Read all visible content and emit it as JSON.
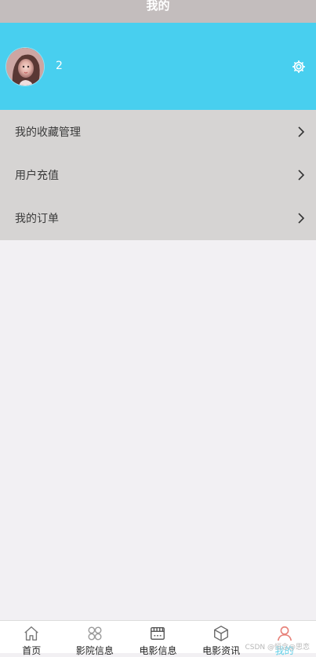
{
  "header": {
    "title": "我的"
  },
  "profile": {
    "username": "2",
    "settings_icon": "gear-icon",
    "avatar_icon": "avatar"
  },
  "menu": {
    "items": [
      {
        "label": "我的收藏管理",
        "icon": "chevron-right-icon"
      },
      {
        "label": "用户充值",
        "icon": "chevron-right-icon"
      },
      {
        "label": "我的订单",
        "icon": "chevron-right-icon"
      }
    ]
  },
  "tabbar": {
    "items": [
      {
        "label": "首页",
        "icon": "home-icon"
      },
      {
        "label": "影院信息",
        "icon": "cinema-icon"
      },
      {
        "label": "电影信息",
        "icon": "film-icon"
      },
      {
        "label": "电影资讯",
        "icon": "news-icon"
      },
      {
        "label": "我的",
        "icon": "user-icon"
      }
    ],
    "active_index": 4
  },
  "watermark": "CSDN @恒念@思恋",
  "colors": {
    "accent": "#48cfef",
    "header": "#c3bdbd",
    "menu_bg": "#d6d4d3",
    "page_bg": "#f2f0f3"
  }
}
